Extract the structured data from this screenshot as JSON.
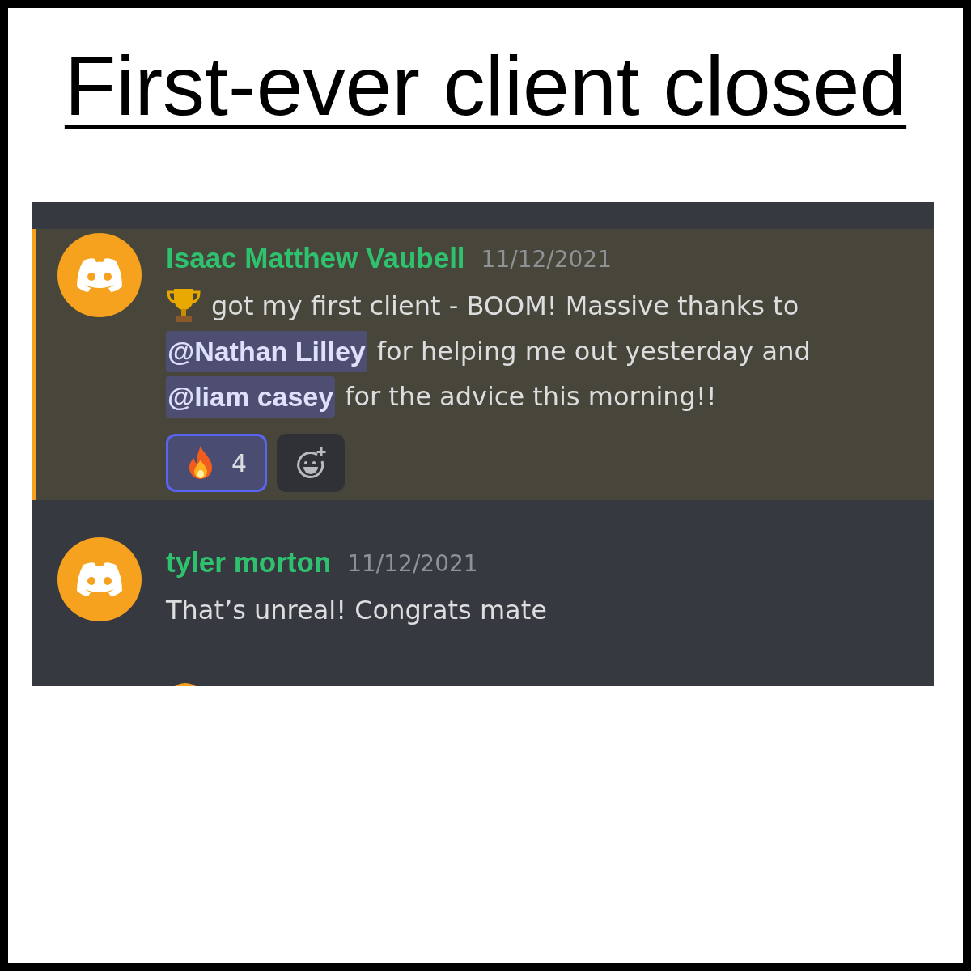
{
  "title": "First-ever client closed",
  "messages": [
    {
      "author": "Isaac Matthew Vaubell",
      "date": "11/12/2021",
      "highlighted": true,
      "lines": [
        [
          {
            "kind": "trophy"
          },
          {
            "kind": "text",
            "text": "got my first client - BOOM! Massive thanks to"
          }
        ],
        [
          {
            "kind": "mention",
            "text": "@Nathan Lilley"
          },
          {
            "kind": "text",
            "text": "for helping me out yesterday and"
          }
        ],
        [
          {
            "kind": "mention",
            "text": "@liam casey"
          },
          {
            "kind": "text",
            "text": "for the advice this morning!!"
          }
        ]
      ],
      "reactions": [
        {
          "kind": "fire",
          "count": "4",
          "selected": true
        }
      ]
    },
    {
      "author": "tyler morton",
      "date": "11/12/2021",
      "highlighted": false,
      "lines": [
        [
          {
            "kind": "text",
            "text": "That’s unreal! Congrats mate"
          }
        ]
      ]
    }
  ]
}
